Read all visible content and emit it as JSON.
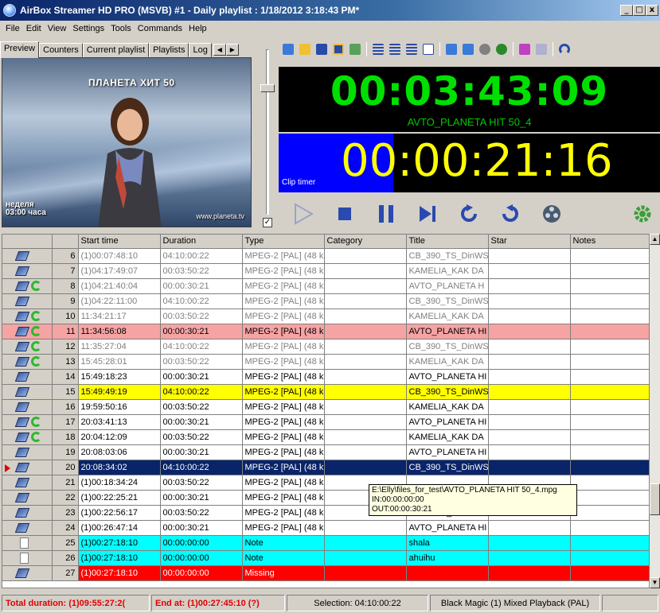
{
  "window": {
    "title": "AirBox Streamer HD PRO (MSVB) #1 - Daily playlist : 1/18/2012 3:18:43 PM*",
    "controls": [
      "_",
      "□",
      "x"
    ]
  },
  "menu": [
    "File",
    "Edit",
    "View",
    "Settings",
    "Tools",
    "Commands",
    "Help"
  ],
  "tabs": [
    "Preview",
    "Counters",
    "Current playlist",
    "Playlists",
    "Log"
  ],
  "preview": {
    "channel": "ПЛАНЕТА ХИТ 50",
    "day_line1": "неделя",
    "day_line2": "03:00 часа",
    "site": "www.planeta.tv"
  },
  "toolbar_icons": [
    "import-icon",
    "open-folder-icon",
    "save-icon",
    "save-as-icon",
    "edit-icon",
    "align-left-icon",
    "indent-icon",
    "outdent-icon",
    "new-page-icon",
    "send-icon",
    "receive-icon",
    "record-icon",
    "refresh-icon",
    "check-icon",
    "screen-icon",
    "undo-icon"
  ],
  "timer": {
    "main": "00:03:43:09",
    "clip_name": "AVTO_PLANETA HIT 50_4",
    "clip": "00:00:21:16",
    "clip_label": "Clip timer",
    "clip_progress": 0.3
  },
  "table": {
    "headers": [
      "",
      "",
      "Start time",
      "Duration",
      "Type",
      "Category",
      "Title",
      "Star",
      "Notes"
    ],
    "rows": [
      {
        "n": "6",
        "start": "(1)00:07:48:10",
        "dur": "04:10:00:22",
        "type": "MPEG-2 [PAL] (48 k",
        "title": "CB_390_TS_DinWS",
        "style": "g",
        "recycle": false
      },
      {
        "n": "7",
        "start": "(1)04:17:49:07",
        "dur": "00:03:50:22",
        "type": "MPEG-2 [PAL] (48 k",
        "title": "KAMELIA_KAK DA",
        "style": "g",
        "recycle": false
      },
      {
        "n": "8",
        "start": "(1)04:21:40:04",
        "dur": "00:00:30:21",
        "type": "MPEG-2 [PAL] (48 k",
        "title": "AVTO_PLANETA H",
        "style": "g",
        "recycle": true
      },
      {
        "n": "9",
        "start": "(1)04:22:11:00",
        "dur": "04:10:00:22",
        "type": "MPEG-2 [PAL] (48 k",
        "title": "CB_390_TS_DinWS",
        "style": "g",
        "recycle": false
      },
      {
        "n": "10",
        "start": "11:34:21:17",
        "dur": "00:03:50:22",
        "type": "MPEG-2 [PAL] (48 k",
        "title": "KAMELIA_KAK DA",
        "style": "g",
        "recycle": true
      },
      {
        "n": "11",
        "start": "11:34:56:08",
        "dur": "00:00:30:21",
        "type": "MPEG-2 [PAL] (48 k",
        "title": "AVTO_PLANETA HI",
        "style": "red",
        "recycle": true
      },
      {
        "n": "12",
        "start": "11:35:27:04",
        "dur": "04:10:00:22",
        "type": "MPEG-2 [PAL] (48 k",
        "title": "CB_390_TS_DinWS",
        "style": "g",
        "recycle": true
      },
      {
        "n": "13",
        "start": "15:45:28:01",
        "dur": "00:03:50:22",
        "type": "MPEG-2 [PAL] (48 k",
        "title": "KAMELIA_KAK DA",
        "style": "g",
        "recycle": true
      },
      {
        "n": "14",
        "start": "15:49:18:23",
        "dur": "00:00:30:21",
        "type": "MPEG-2 [PAL] (48 k",
        "title": "AVTO_PLANETA HI",
        "style": "",
        "recycle": false
      },
      {
        "n": "15",
        "start": "15:49:49:19",
        "dur": "04:10:00:22",
        "type": "MPEG-2 [PAL] (48 k",
        "title": "CB_390_TS_DinWS",
        "style": "yellow",
        "recycle": false
      },
      {
        "n": "16",
        "start": "19:59:50:16",
        "dur": "00:03:50:22",
        "type": "MPEG-2 [PAL] (48 k",
        "title": "KAMELIA_KAK DA",
        "style": "",
        "recycle": false
      },
      {
        "n": "17",
        "start": "20:03:41:13",
        "dur": "00:00:30:21",
        "type": "MPEG-2 [PAL] (48 k",
        "title": "AVTO_PLANETA HI",
        "style": "",
        "recycle": true
      },
      {
        "n": "18",
        "start": "20:04:12:09",
        "dur": "00:03:50:22",
        "type": "MPEG-2 [PAL] (48 k",
        "title": "KAMELIA_KAK DA",
        "style": "",
        "recycle": true
      },
      {
        "n": "19",
        "start": "20:08:03:06",
        "dur": "00:00:30:21",
        "type": "MPEG-2 [PAL] (48 k",
        "title": "AVTO_PLANETA HI",
        "style": "",
        "recycle": false
      },
      {
        "n": "20",
        "start": "20:08:34:02",
        "dur": "04:10:00:22",
        "type": "MPEG-2 [PAL] (48 k",
        "title": "CB_390_TS_DinWS",
        "style": "sel",
        "recycle": false,
        "current": true
      },
      {
        "n": "21",
        "start": "(1)00:18:34:24",
        "dur": "00:03:50:22",
        "type": "MPEG-2 [PAL] (48 k",
        "title": "",
        "style": "",
        "recycle": false
      },
      {
        "n": "22",
        "start": "(1)00:22:25:21",
        "dur": "00:00:30:21",
        "type": "MPEG-2 [PAL] (48 k",
        "title": "",
        "style": "",
        "recycle": false
      },
      {
        "n": "23",
        "start": "(1)00:22:56:17",
        "dur": "00:03:50:22",
        "type": "MPEG-2 [PAL] (48 k",
        "title": "KAMELIA_KAK DA",
        "style": "",
        "recycle": false
      },
      {
        "n": "24",
        "start": "(1)00:26:47:14",
        "dur": "00:00:30:21",
        "type": "MPEG-2 [PAL] (48 k",
        "title": "AVTO_PLANETA HI",
        "style": "",
        "recycle": false
      },
      {
        "n": "25",
        "start": "(1)00:27:18:10",
        "dur": "00:00:00:00",
        "type": "Note",
        "title": "shala",
        "style": "cyan",
        "recycle": false,
        "note": true
      },
      {
        "n": "26",
        "start": "(1)00:27:18:10",
        "dur": "00:00:00:00",
        "type": "Note",
        "title": "ahuihu",
        "style": "cyan",
        "recycle": false,
        "note": true
      },
      {
        "n": "27",
        "start": "(1)00:27:18:10",
        "dur": "00:00:00:00",
        "type": "Missing",
        "title": "",
        "style": "missing",
        "recycle": false
      }
    ]
  },
  "tooltip": {
    "line1": "E:\\Elly\\files_for_test\\AVTO_PLANETA HIT 50_4.mpg",
    "line2": "IN:00:00:00:00",
    "line3": "OUT:00:00:30:21"
  },
  "status": {
    "total": "Total duration: (1)09:55:27:2(",
    "end": "End at: (1)00:27:45:10 (?)",
    "selection": "Selection: 04:10:00:22",
    "device": "Black Magic (1) Mixed Playback (PAL)"
  },
  "colors": {
    "main_timer": "#00e000",
    "clip_timer": "#ffff00",
    "clip_fill": "#0000ff",
    "row_red": "#f5a3a3",
    "row_yellow": "#ffff00",
    "row_selected": "#0a246a",
    "row_cyan": "#00ffff",
    "row_missing": "#ff0000"
  }
}
